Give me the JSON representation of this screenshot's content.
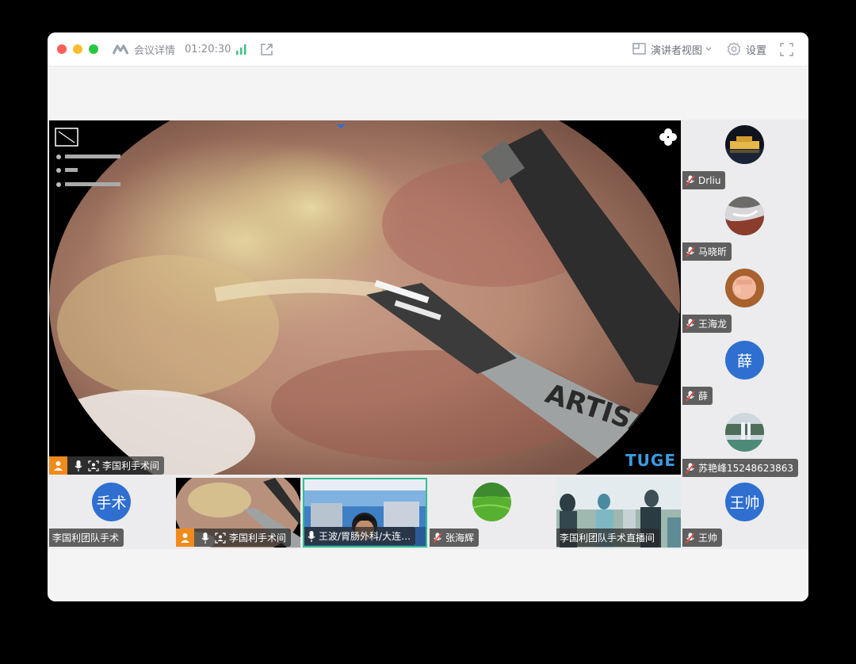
{
  "titlebar": {
    "app_label": "会议详情",
    "timer": "01:20:30",
    "presenter_view_label": "演讲者视图",
    "settings_label": "设置"
  },
  "main_video": {
    "tag": {
      "label": "李国利手术间"
    },
    "overlay_brand": "TUGE"
  },
  "side_participants": [
    {
      "name": "Drliu",
      "avatar": "photo-night-building",
      "mic": "muted"
    },
    {
      "name": "马晓昕",
      "avatar": "photo-waterfall",
      "mic": "muted"
    },
    {
      "name": "王海龙",
      "avatar": "photo-fist",
      "mic": "muted"
    },
    {
      "name": "薛",
      "avatar_text": "薛",
      "mic": "muted"
    },
    {
      "name": "苏艳峰15248623863",
      "avatar": "photo-waterfall-green",
      "mic": "muted"
    }
  ],
  "bottom_participants": [
    {
      "name": "李国利团队手术",
      "avatar_text": "手术"
    },
    {
      "name": "李国利手术间",
      "mic": "on"
    },
    {
      "name": "王波/胃肠外科/大连…",
      "mic": "on"
    },
    {
      "name": "张海辉",
      "avatar": "photo-green-hill",
      "mic": "muted"
    },
    {
      "name": "李国利团队手术直播间"
    },
    {
      "name": "王帅",
      "avatar_text": "王帅",
      "mic": "muted"
    }
  ],
  "colors": {
    "avatar_blue": "#2f6fd0",
    "active_border": "#2fbf8f",
    "host_orange": "#f08a1c",
    "signal_green": "#3cc486"
  }
}
